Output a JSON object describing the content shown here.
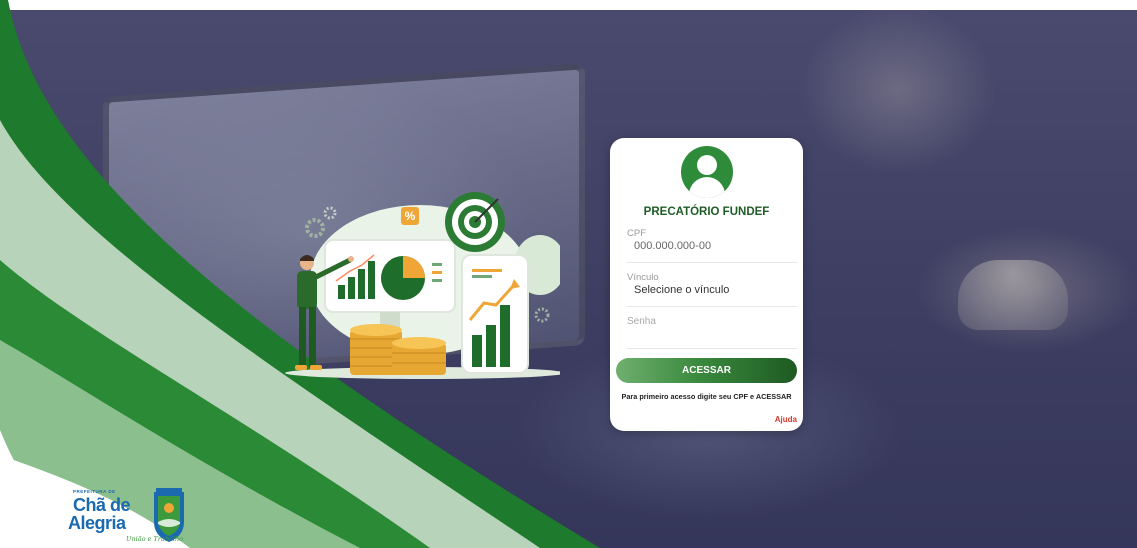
{
  "login": {
    "title": "PRECATÓRIO FUNDEF",
    "cpf_label": "CPF",
    "cpf_placeholder": "000.000.000-00",
    "vinculo_label": "Vínculo",
    "vinculo_value": "Selecione o vínculo",
    "senha_placeholder": "Senha",
    "submit_label": "ACESSAR",
    "hint": "Para primeiro acesso digite seu CPF e ACESSAR",
    "help_link": "Ajuda"
  },
  "logo": {
    "sub": "PREFEITURA DE",
    "name_line1": "Chã de",
    "name_line2": "Alegria",
    "slogan": "União e Trabalho"
  },
  "illustration": {
    "percent_badge": "%"
  },
  "colors": {
    "brand_green": "#2e8b3a",
    "title_green": "#1f5c26",
    "help_red": "#d23a2a",
    "logo_blue": "#1b6ab0"
  },
  "icons": [
    "user-avatar-icon",
    "target-icon",
    "percent-icon",
    "gear-icon",
    "coins-icon",
    "bar-chart-icon",
    "pie-chart-icon"
  ]
}
